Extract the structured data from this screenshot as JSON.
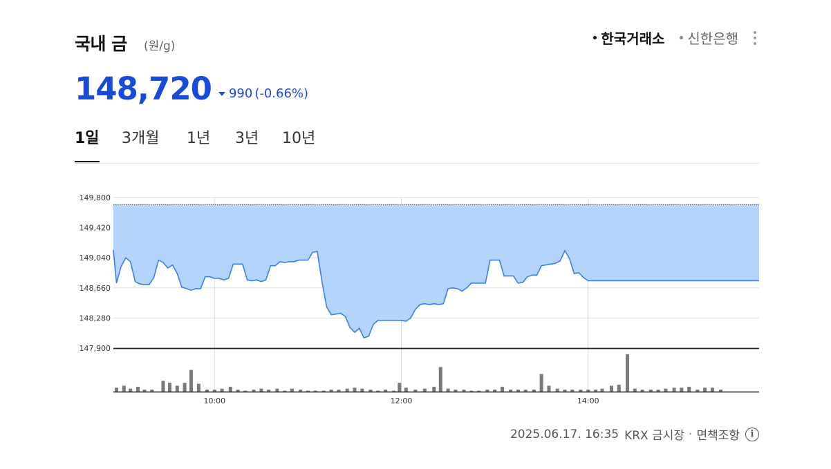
{
  "header": {
    "title": "국내 금",
    "unit": "(원/g)",
    "sources": [
      {
        "label": "한국거래소",
        "active": true
      },
      {
        "label": "신한은행",
        "active": false
      }
    ]
  },
  "quote": {
    "price": "148,720",
    "change": "990",
    "change_pct": "(-0.66%)",
    "direction": "down"
  },
  "tabs": [
    {
      "label": "1일",
      "active": true
    },
    {
      "label": "3개월",
      "active": false
    },
    {
      "label": "1년",
      "active": false
    },
    {
      "label": "3년",
      "active": false
    },
    {
      "label": "10년",
      "active": false
    }
  ],
  "colors": {
    "accent": "#1a4ad8",
    "line": "#3b7df0",
    "fill": "#b3d4fb",
    "volume": "#7a7a7a"
  },
  "chart_data": {
    "type": "area",
    "x_range": [
      8.917,
      15.83
    ],
    "ylim": [
      147900,
      149800
    ],
    "yticks": [
      149800,
      149420,
      149040,
      148660,
      148280,
      147900
    ],
    "ytick_labels": [
      "149,800",
      "149,420",
      "149,040",
      "148,660",
      "148,280",
      "147,900"
    ],
    "xticks": [
      10,
      12,
      14
    ],
    "xtick_labels": [
      "10:00",
      "12:00",
      "14:00"
    ],
    "reference_level": 149710,
    "grid": true,
    "series": [
      {
        "x": [
          8.917,
          8.95,
          9.0,
          9.05,
          9.1,
          9.15,
          9.2,
          9.25,
          9.3,
          9.35,
          9.4,
          9.45,
          9.5,
          9.55,
          9.6,
          9.65,
          9.7,
          9.75,
          9.8,
          9.85,
          9.9,
          9.95,
          10.0,
          10.05,
          10.1,
          10.15,
          10.2,
          10.25,
          10.3,
          10.35,
          10.4,
          10.45,
          10.5,
          10.55,
          10.6,
          10.65,
          10.7,
          10.75,
          10.8,
          10.85,
          10.9,
          10.95,
          11.0,
          11.05,
          11.1,
          11.15,
          11.2,
          11.25,
          11.3,
          11.35,
          11.4,
          11.45,
          11.5,
          11.55,
          11.6,
          11.65,
          11.7,
          11.75,
          11.8,
          11.85,
          11.9,
          11.95,
          12.0,
          12.05,
          12.1,
          12.15,
          12.2,
          12.25,
          12.3,
          12.35,
          12.4,
          12.45,
          12.5,
          12.55,
          12.6,
          12.65,
          12.7,
          12.75,
          12.8,
          12.85,
          12.9,
          12.95,
          13.0,
          13.05,
          13.1,
          13.15,
          13.2,
          13.25,
          13.3,
          13.35,
          13.4,
          13.45,
          13.5,
          13.55,
          13.6,
          13.65,
          13.7,
          13.75,
          13.8,
          13.85,
          13.9,
          13.95,
          14.0,
          14.05,
          14.1,
          14.15,
          14.2,
          14.25,
          14.3,
          14.35,
          14.4,
          14.45,
          14.5,
          14.55,
          14.6,
          14.65,
          14.7,
          14.75,
          14.8,
          14.85,
          14.9,
          14.95,
          15.0,
          15.05,
          15.1,
          15.15,
          15.2,
          15.25,
          15.3,
          15.35,
          15.4,
          15.45,
          15.5,
          15.55,
          15.6,
          15.65,
          15.7,
          15.75,
          15.83
        ],
        "values": [
          149140,
          148720,
          148930,
          149040,
          148990,
          148740,
          148710,
          148700,
          148700,
          148790,
          149010,
          148980,
          148910,
          148950,
          148840,
          148670,
          148650,
          148630,
          148650,
          148650,
          148800,
          148800,
          148780,
          148780,
          148760,
          148780,
          148960,
          148960,
          148960,
          148760,
          148750,
          148760,
          148740,
          148760,
          148940,
          148940,
          148990,
          148980,
          148990,
          148990,
          149010,
          149010,
          149010,
          149110,
          149120,
          148740,
          148420,
          148320,
          148330,
          148340,
          148300,
          148160,
          148100,
          148150,
          148030,
          148050,
          148200,
          148250,
          148250,
          148250,
          148250,
          148250,
          148250,
          148240,
          148280,
          148390,
          148450,
          148460,
          148450,
          148460,
          148450,
          148460,
          148650,
          148660,
          148650,
          148620,
          148660,
          148720,
          148720,
          148720,
          148720,
          149010,
          149010,
          149010,
          148810,
          148810,
          148810,
          148720,
          148730,
          148800,
          148820,
          148820,
          148940,
          148950,
          148960,
          148970,
          149000,
          149130,
          149030,
          148840,
          148850,
          148790,
          148750,
          148750,
          148750,
          148750,
          148750,
          148750,
          148750,
          148750,
          148750,
          148750,
          148750,
          148750,
          148750,
          148750,
          148750,
          148750,
          148750,
          148750,
          148750,
          148750,
          148750,
          148750,
          148750,
          148750,
          148750,
          148750,
          148750,
          148750,
          148750,
          148750,
          148750,
          148750,
          148750,
          148750,
          148750,
          148750,
          148750
        ]
      }
    ],
    "volume": {
      "x": [
        8.95,
        9.03,
        9.1,
        9.18,
        9.25,
        9.33,
        9.45,
        9.52,
        9.6,
        9.68,
        9.75,
        9.83,
        9.92,
        10.0,
        10.08,
        10.17,
        10.25,
        10.33,
        10.42,
        10.5,
        10.58,
        10.67,
        10.75,
        10.83,
        10.92,
        11.0,
        11.08,
        11.17,
        11.25,
        11.33,
        11.42,
        11.5,
        11.58,
        11.67,
        11.75,
        11.83,
        11.92,
        11.98,
        12.05,
        12.15,
        12.25,
        12.35,
        12.42,
        12.5,
        12.58,
        12.67,
        12.75,
        12.83,
        12.92,
        13.0,
        13.08,
        13.17,
        13.25,
        13.33,
        13.42,
        13.5,
        13.58,
        13.67,
        13.75,
        13.83,
        13.92,
        14.0,
        14.08,
        14.15,
        14.25,
        14.33,
        14.42,
        14.5,
        14.58,
        14.67,
        14.75,
        14.83,
        14.92,
        15.0,
        15.08,
        15.17,
        15.25,
        15.33,
        15.42
      ],
      "values": [
        4,
        6,
        3,
        5,
        2,
        2,
        11,
        9,
        6,
        9,
        22,
        8,
        2,
        2,
        3,
        5,
        2,
        1,
        2,
        3,
        2,
        3,
        1,
        3,
        2,
        1,
        1,
        1,
        2,
        2,
        3,
        4,
        3,
        2,
        1,
        2,
        1,
        9,
        4,
        2,
        3,
        5,
        25,
        3,
        2,
        2,
        1,
        1,
        2,
        2,
        5,
        2,
        2,
        2,
        2,
        18,
        6,
        3,
        2,
        2,
        2,
        2,
        2,
        3,
        6,
        7,
        38,
        3,
        2,
        2,
        2,
        3,
        4,
        4,
        5,
        2,
        4,
        4,
        2
      ]
    }
  },
  "footer": {
    "timestamp": "2025.06.17. 16:35",
    "source": "KRX 금시장",
    "separator": "·",
    "disclaimer": "면책조항",
    "info_glyph": "i"
  }
}
